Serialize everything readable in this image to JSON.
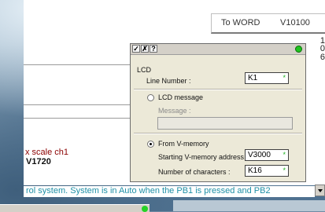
{
  "word_table": {
    "label": "To WORD",
    "value": "V10100"
  },
  "right_edge_values": [
    "1",
    "0",
    "6"
  ],
  "background_text": {
    "scale_label": "x scale ch1",
    "vmem": "V1720",
    "rung_comment": "rol system. System is in Auto when the PB1 is pressed and PB2"
  },
  "dialog": {
    "toolbar": {
      "accept": "✓",
      "cancel": "✗",
      "help": "?"
    },
    "section_title": "LCD",
    "line_number": {
      "label": "Line Number :",
      "value": "K1",
      "marker": "*"
    },
    "lcd_message": {
      "label": "LCD message",
      "selected": false
    },
    "message": {
      "label": "Message :",
      "value": "",
      "disabled": true
    },
    "from_vmemory": {
      "label": "From V-memory",
      "selected": true
    },
    "start_address": {
      "label": "Starting V-memory address :",
      "value": "V3000",
      "marker": "*"
    },
    "num_chars": {
      "label": "Number of characters :",
      "value": "K16",
      "marker": "*"
    }
  },
  "colors": {
    "status_led": "#1fc41f",
    "comment_text": "#1e8fa6",
    "label_text": "#8b0000"
  }
}
